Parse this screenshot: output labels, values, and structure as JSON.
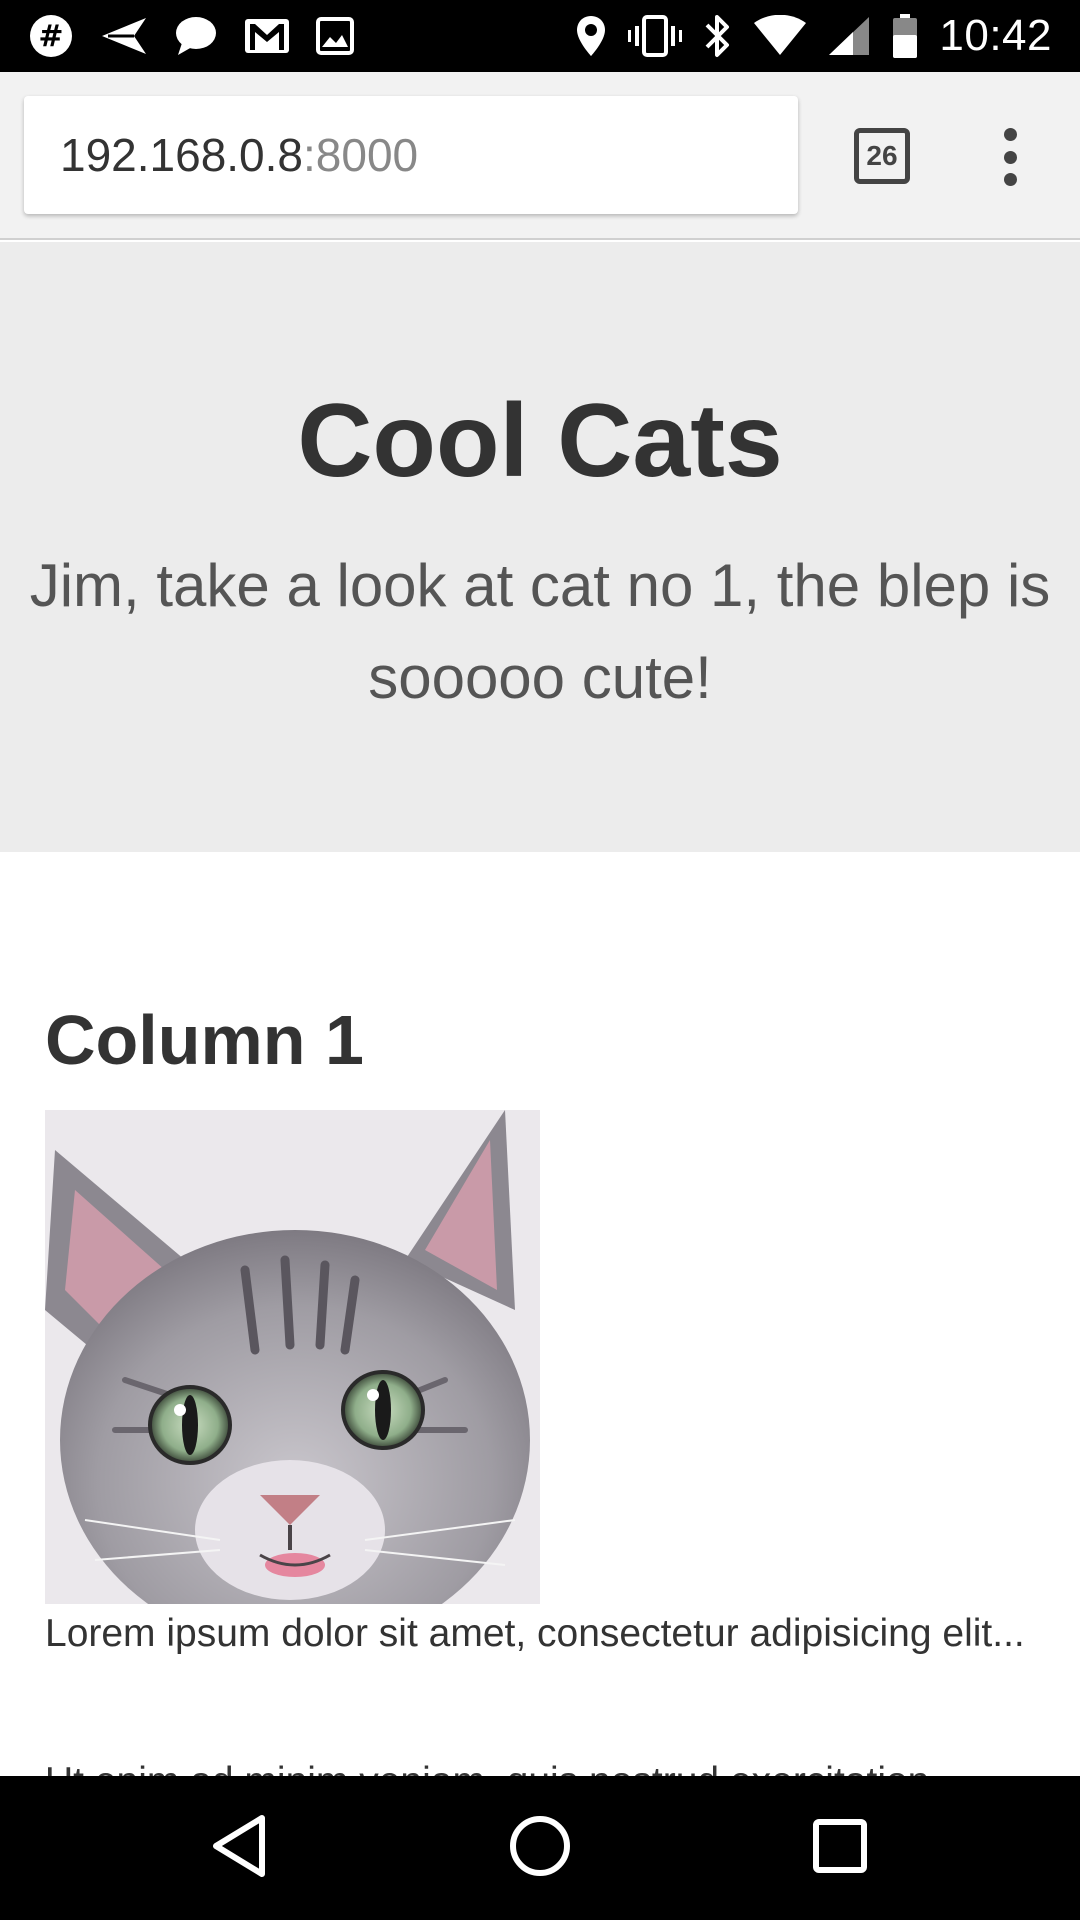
{
  "status_bar": {
    "time": "10:42",
    "left_icons": [
      "hashtag-notification-icon",
      "send-notification-icon",
      "chat-notification-icon",
      "gmail-notification-icon",
      "image-notification-icon"
    ],
    "right_icons": [
      "location-icon",
      "vibrate-icon",
      "bluetooth-icon",
      "wifi-icon",
      "cell-signal-icon",
      "battery-icon"
    ]
  },
  "browser": {
    "url_host": "192.168.0.8",
    "url_port": ":8000",
    "tab_count": "26"
  },
  "hero": {
    "title": "Cool Cats",
    "subtitle": "Jim, take a look at cat no 1, the blep is sooooo cute!"
  },
  "column": {
    "heading": "Column 1",
    "text_1": "Lorem ipsum dolor sit amet, consectetur adipisicing elit...",
    "text_2": "Ut enim ad minim veniam, quis nostrud exercitation"
  },
  "nav_bar": {
    "icons": [
      "back-icon",
      "home-icon",
      "recents-icon"
    ]
  },
  "colors": {
    "hero_background": "#ececec",
    "text_dark": "#333333",
    "system_bars": "#000000"
  }
}
